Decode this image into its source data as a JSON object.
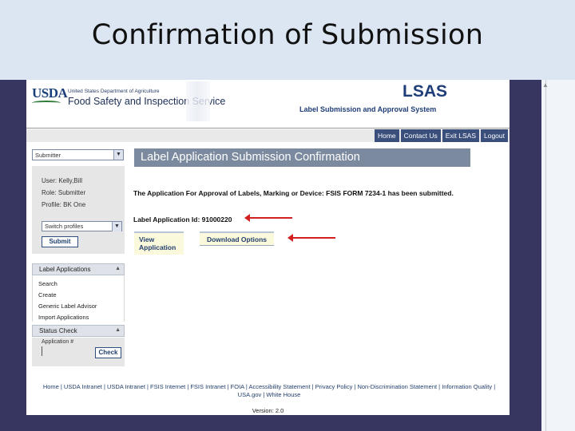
{
  "slide": {
    "title": "Confirmation of Submission"
  },
  "header": {
    "agency_logo": "USDA",
    "department": "United States Department of Agriculture",
    "service": "Food Safety and Inspection Service",
    "app_name": "LSAS",
    "app_full_name": "Label Submission and Approval System"
  },
  "topnav": {
    "items": [
      "Home",
      "Contact Us",
      "Exit LSAS",
      "Logout"
    ]
  },
  "sidebar": {
    "role_selected": "Submitter",
    "user": "User: Kelly,Bill",
    "role": "Role: Submitter",
    "profile": "Profile: BK One",
    "profile_select": "Switch profiles",
    "submit_label": "Submit",
    "label_apps_title": "Label Applications",
    "label_apps_links": [
      "Search",
      "Create",
      "Generic Label Advisor",
      "Import Applications"
    ],
    "status_title": "Status Check",
    "app_number_label": "Application #",
    "check_label": "Check"
  },
  "main": {
    "title": "Label Application Submission Confirmation",
    "message": "The Application For Approval of Labels, Marking or Device: FSIS FORM 7234-1 has been submitted.",
    "app_id_text": "Label Application Id: 91000220",
    "view_label": "View Application",
    "download_label": "Download Options"
  },
  "footer": {
    "links_line1": "Home | USDA Intranet | USDA Intranet | FSIS Internet | FSIS Intranet | FOIA | Accessibility Statement | Privacy Policy | Non-Discrimination Statement | Information Quality |",
    "links_line2": "USA.gov | White House",
    "version": "Version: 2.0"
  },
  "colors": {
    "frame": "#363661",
    "nav": "#3a4f7b",
    "title_bar": "#7b8a9e",
    "arrow": "#d22020",
    "highlight": "#fbf9dc"
  }
}
